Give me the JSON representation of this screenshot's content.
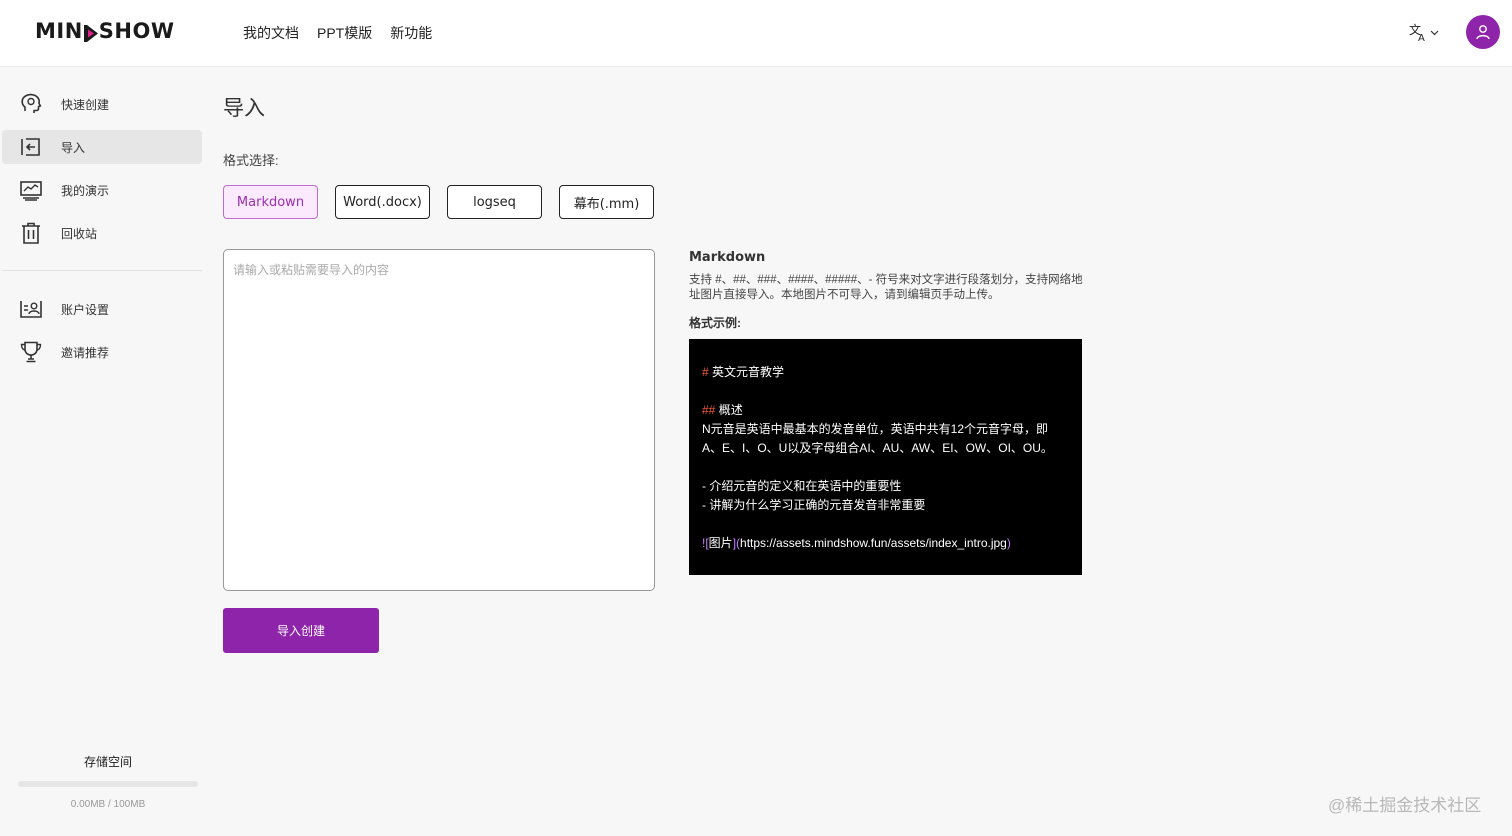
{
  "header": {
    "logo": {
      "part1": "MIN",
      "part2": "SHOW"
    },
    "nav": [
      "我的文档",
      "PPT模版",
      "新功能"
    ],
    "lang_icon": "translate-icon",
    "avatar_icon": "user-icon",
    "accent_color": "#8e24aa"
  },
  "sidebar": {
    "items": [
      {
        "label": "快速创建",
        "icon": "brain-icon"
      },
      {
        "label": "导入",
        "icon": "import-icon"
      },
      {
        "label": "我的演示",
        "icon": "presentation-icon"
      },
      {
        "label": "回收站",
        "icon": "trash-icon"
      }
    ],
    "items2": [
      {
        "label": "账户设置",
        "icon": "account-settings-icon"
      },
      {
        "label": "邀请推荐",
        "icon": "trophy-icon"
      }
    ],
    "storage": {
      "title": "存储空间",
      "text": "0.00MB / 100MB",
      "used_fraction": 0
    }
  },
  "main": {
    "title": "导入",
    "format_label": "格式选择:",
    "formats": [
      "Markdown",
      "Word(.docx)",
      "logseq",
      "幕布(.mm)"
    ],
    "selected_format": "Markdown",
    "textarea_placeholder": "请输入或粘贴需要导入的内容",
    "textarea_value": "",
    "submit_label": "导入创建"
  },
  "info": {
    "title": "Markdown",
    "desc": "支持 #、##、###、####、#####、- 符号来对文字进行段落划分，支持网络地址图片直接导入。本地图片不可导入，请到编辑页手动上传。",
    "example_label": "格式示例:",
    "example": {
      "h1_mark": "#",
      "h1_text": " 英文元音教学",
      "h2_mark": "##",
      "h2_text": " 概述",
      "para1": " N元音是英语中最基本的发音单位，英语中共有12个元音字母，即",
      "para2": "A、E、I、O、U以及字母组合AI、AU、AW、EI、OW、OI、OU。",
      "bullet1": "- 介绍元音的定义和在英语中的重要性",
      "bullet2": "- 讲解为什么学习正确的元音发音非常重要",
      "img_open": "![",
      "img_alt": "图片",
      "img_mid": "](",
      "img_url": "https://assets.mindshow.fun/assets/index_intro.jpg",
      "img_close": ")"
    }
  },
  "watermark": "@稀土掘金技术社区"
}
